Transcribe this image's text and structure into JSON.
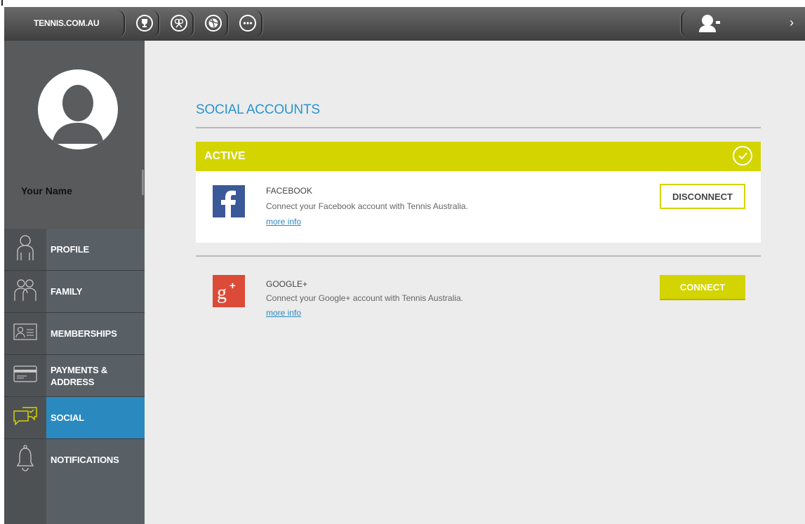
{
  "topbar": {
    "brand": "TENNIS.COM.AU",
    "icons": [
      "trophy-icon",
      "crossed-rackets-icon",
      "tennis-ball-icon",
      "more-icon"
    ],
    "user_icon": "user-icon",
    "chevron": "›"
  },
  "sidebar": {
    "user_name": "Your Name",
    "items": [
      {
        "label": "PROFILE",
        "icon": "person-icon"
      },
      {
        "label": "FAMILY",
        "icon": "family-icon"
      },
      {
        "label": "MEMBERSHIPS",
        "icon": "membership-card-icon"
      },
      {
        "label": "PAYMENTS &\nADDRESS",
        "icon": "credit-card-icon"
      },
      {
        "label": "SOCIAL",
        "icon": "chat-bubbles-icon"
      },
      {
        "label": "NOTIFICATIONS",
        "icon": "bell-icon"
      }
    ],
    "active_item": "SOCIAL"
  },
  "main": {
    "title": "SOCIAL ACCOUNTS",
    "active_label": "ACTIVE",
    "accounts": [
      {
        "name": "FACEBOOK",
        "description": "Connect your Facebook account with Tennis Australia.",
        "link": "more info",
        "button": "DISCONNECT",
        "status": "active"
      },
      {
        "name": "GOOGLE+",
        "description": "Connect your Google+ account with Tennis Australia.",
        "link": "more info",
        "button": "CONNECT",
        "status": "inactive"
      }
    ]
  },
  "colors": {
    "accent_blue": "#2a8ac0",
    "active_yellow": "#d4d400",
    "facebook_blue": "#3b5998",
    "google_red": "#dc4a38"
  }
}
